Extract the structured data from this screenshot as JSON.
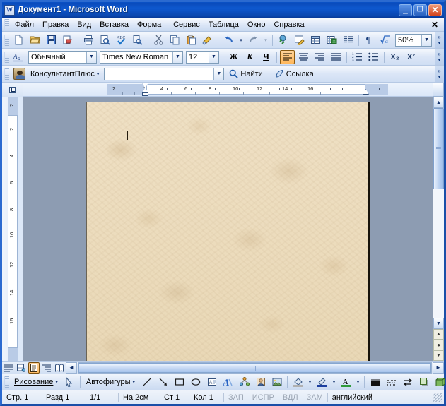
{
  "window": {
    "title": "Документ1 - Microsoft Word",
    "app_icon": "word-document-icon",
    "minimize_label": "_",
    "maximize_label": "❐",
    "close_label": "✕"
  },
  "menubar": {
    "items": [
      {
        "label": "Файл",
        "name": "menu-file"
      },
      {
        "label": "Правка",
        "name": "menu-edit"
      },
      {
        "label": "Вид",
        "name": "menu-view"
      },
      {
        "label": "Вставка",
        "name": "menu-insert"
      },
      {
        "label": "Формат",
        "name": "menu-format"
      },
      {
        "label": "Сервис",
        "name": "menu-tools"
      },
      {
        "label": "Таблица",
        "name": "menu-table"
      },
      {
        "label": "Окно",
        "name": "menu-window"
      },
      {
        "label": "Справка",
        "name": "menu-help"
      }
    ],
    "close_document_label": "✕"
  },
  "standard_toolbar": {
    "buttons": [
      "new-document-icon",
      "open-folder-icon",
      "save-disk-icon",
      "email-icon",
      "print-icon",
      "print-preview-icon",
      "spelling-check-icon",
      "research-icon",
      "cut-scissors-icon",
      "copy-icon",
      "paste-icon",
      "format-painter-icon",
      "undo-icon",
      "redo-icon",
      "insert-hyperlink-icon",
      "tables-and-borders-icon",
      "insert-table-icon",
      "insert-excel-sheet-icon",
      "columns-icon",
      "show-formatting-marks-icon",
      "equation-icon"
    ],
    "zoom_value": "50%",
    "overflow_label": "»"
  },
  "formatting_toolbar": {
    "style_value": "Обычный",
    "font_value": "Times New Roman",
    "size_value": "12",
    "bold_label": "Ж",
    "italic_label": "К",
    "underline_label": "Ч",
    "align_left_name": "align-left-icon",
    "align_center_name": "align-center-icon",
    "align_right_name": "align-right-icon",
    "align_justify_name": "align-justify-icon",
    "numbered_list_name": "numbered-list-icon",
    "bulleted_list_name": "bulleted-list-icon",
    "subscript_label": "X₂",
    "superscript_label": "X²",
    "overflow_label": "»"
  },
  "consultant_toolbar": {
    "name_label": "КонсультантПлюс",
    "search_value": "",
    "find_label": "Найти",
    "link_label": "Ссылка",
    "overflow_label": "»"
  },
  "rulers": {
    "horizontal_ticks": [
      "2",
      "2",
      "4",
      "6",
      "8",
      "10",
      "12",
      "14",
      "16"
    ],
    "vertical_ticks": [
      "2",
      "2",
      "4",
      "6",
      "8",
      "10",
      "12",
      "14",
      "16"
    ],
    "tab_stop_label": "L"
  },
  "document": {
    "background_style": "papyrus-texture",
    "caret_visible": true
  },
  "view_buttons": {
    "items": [
      {
        "name": "view-normal",
        "active": false
      },
      {
        "name": "view-web-layout",
        "active": false
      },
      {
        "name": "view-print-layout",
        "active": true
      },
      {
        "name": "view-outline",
        "active": false
      },
      {
        "name": "view-reading",
        "active": false
      }
    ]
  },
  "scrollbars": {
    "up_arrow": "▲",
    "down_arrow": "▼",
    "left_arrow": "◄",
    "right_arrow": "►",
    "browse_prev": "⯅",
    "browse_select": "●",
    "browse_next": "⯆"
  },
  "drawing_toolbar": {
    "drawing_label": "Рисование",
    "select_objects_name": "select-arrow-icon",
    "autoshapes_label": "Автофигуры",
    "buttons": [
      "line-icon",
      "arrow-icon",
      "rectangle-icon",
      "oval-icon",
      "text-box-icon",
      "word-art-icon",
      "diagram-icon",
      "clip-art-icon",
      "picture-icon",
      "fill-color-icon",
      "line-color-icon",
      "font-color-icon",
      "line-style-icon",
      "dash-style-icon",
      "arrow-style-icon",
      "shadow-style-icon",
      "3d-style-icon"
    ],
    "overflow_label": "»"
  },
  "statusbar": {
    "page_label": "Стр. 1",
    "section_label": "Разд 1",
    "page_of_label": "1/1",
    "at_label": "На 2см",
    "line_label": "Ст 1",
    "column_label": "Кол 1",
    "rec_label": "ЗАП",
    "trk_label": "ИСПР",
    "ext_label": "ВДЛ",
    "ovr_label": "ЗАМ",
    "language_label": "английский"
  },
  "colors": {
    "titlebar_blue": "#0a4bbb",
    "toolbar_blue": "#dbe6f7",
    "canvas_grey": "#8d9cb2",
    "page_parchment": "#ecdcbd",
    "accent_orange": "#ffbd68"
  }
}
